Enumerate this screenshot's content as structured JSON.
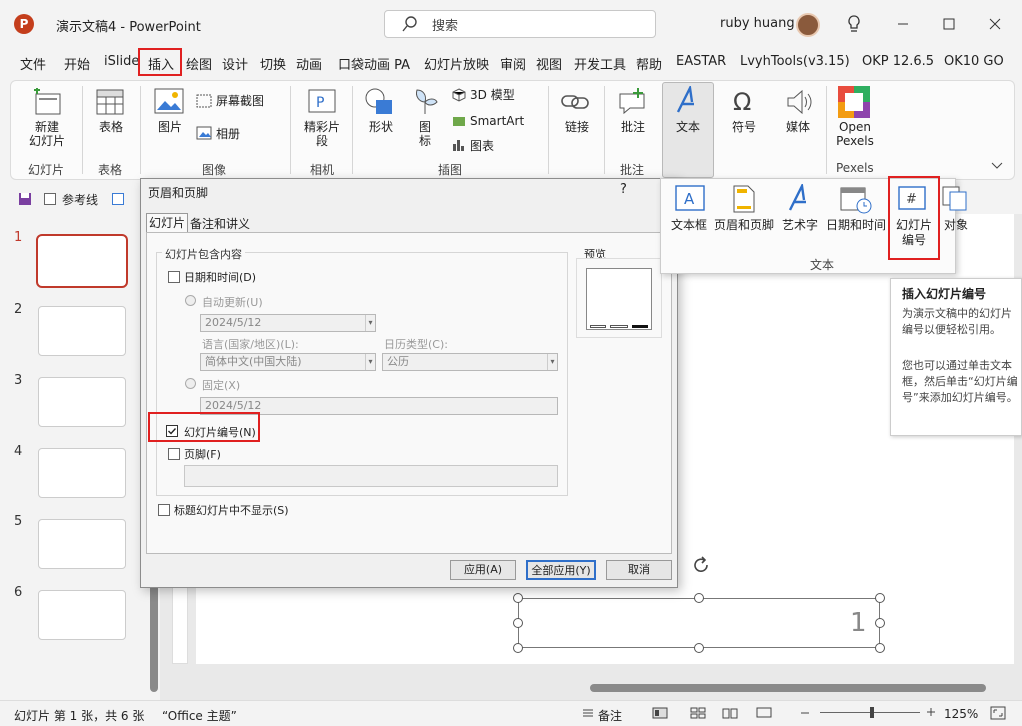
{
  "window": {
    "title": "演示文稿4  -  PowerPoint",
    "logo": "P",
    "search_placeholder": "搜索",
    "user": "ruby huang"
  },
  "menu": [
    "文件",
    "开始",
    "iSlide",
    "插入",
    "绘图",
    "设计",
    "切换",
    "动画",
    "口袋动画 PA",
    "幻灯片放映",
    "审阅",
    "视图",
    "开发工具",
    "帮助",
    "EASTAR",
    "LvyhTools(v3.15)",
    "OKP 12.6.5",
    "OK10 GO"
  ],
  "ribbon": {
    "new_slide": "新建\n幻灯片",
    "table": "表格",
    "picture": "图片",
    "screenshot": "屏幕截图",
    "album": "相册",
    "snippet": "精彩片\n段",
    "shapes": "形状",
    "icons": "图\n标",
    "model3d": "3D 模型",
    "smartart": "SmartArt",
    "chart": "图表",
    "link": "链接",
    "comment": "批注",
    "text": "文本",
    "symbol": "符号",
    "media": "媒体",
    "pexels": "Open\nPexels",
    "groups": {
      "slides": "幻灯片",
      "table": "表格",
      "images": "图像",
      "camera": "相机",
      "illustrations": "插图",
      "comments": "批注",
      "pexels": "Pexels"
    }
  },
  "quickrow": {
    "guides": "参考线"
  },
  "slides": {
    "numbers": [
      "1",
      "2",
      "3",
      "4",
      "5",
      "6"
    ]
  },
  "canvas": {
    "slide_number_text": "1"
  },
  "status": {
    "slide_info": "幻灯片 第 1 张，共 6 张",
    "theme": "“Office 主题”",
    "notes": "备注",
    "zoom": "125%"
  },
  "dialog": {
    "title": "页眉和页脚",
    "help": "?",
    "tabs": [
      "幻灯片",
      "备注和讲义"
    ],
    "group_title": "幻灯片包含内容",
    "date_time": "日期和时间(D)",
    "auto_update": "自动更新(U)",
    "auto_date": "2024/5/12",
    "language_label": "语言(国家/地区)(L):",
    "language": "简体中文(中国大陆)",
    "calendar_label": "日历类型(C):",
    "calendar": "公历",
    "fixed": "固定(X)",
    "fixed_date": "2024/5/12",
    "slide_number": "幻灯片编号(N)",
    "footer": "页脚(F)",
    "hide_title": "标题幻灯片中不显示(S)",
    "preview": "预览",
    "apply": "应用(A)",
    "apply_all": "全部应用(Y)",
    "cancel": "取消"
  },
  "gallery": {
    "items": [
      "文本框",
      "页眉和页脚",
      "艺术字",
      "日期和时间",
      "幻灯片\n编号",
      "对象"
    ],
    "group": "文本"
  },
  "tooltip": {
    "title": "插入幻灯片编号",
    "body1": "为演示文稿中的幻灯片编号以便轻松引用。",
    "body2": "您也可以通过单击文本框，然后单击“幻灯片编号”来添加幻灯片编号。"
  },
  "colors": {
    "accent": "#c43e1c",
    "highlight": "#e02020",
    "ppt_blue": "#2f6fc9"
  }
}
